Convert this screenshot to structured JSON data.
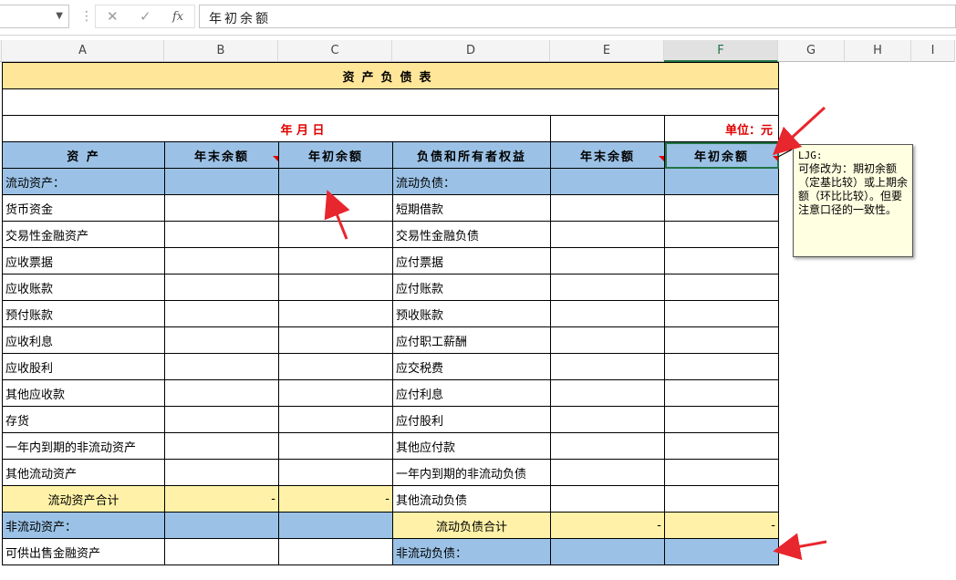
{
  "formula_bar": {
    "name_box": "",
    "cancel_icon": "✕",
    "enter_icon": "✓",
    "fx_label": "fx",
    "formula_value": "年初余额"
  },
  "columns": [
    "A",
    "B",
    "C",
    "D",
    "E",
    "F",
    "G",
    "H",
    "I"
  ],
  "selected_column": "F",
  "sheet": {
    "title": "资产负债表",
    "date_label": "年    月    日",
    "unit_label": "单位：元",
    "headers": [
      "资    产",
      "年末余额",
      "年初余额",
      "负债和所有者权益",
      "年末余额",
      "年初余额"
    ],
    "rows": [
      {
        "a": "流动资产：",
        "b": "",
        "c": "",
        "d": "流动负债：",
        "e": "",
        "f": "",
        "style": "blue"
      },
      {
        "a": "货币资金",
        "d": "短期借款"
      },
      {
        "a": "交易性金融资产",
        "d": "交易性金融负债"
      },
      {
        "a": "应收票据",
        "d": "应付票据"
      },
      {
        "a": "应收账款",
        "d": "应付账款"
      },
      {
        "a": "预付账款",
        "d": "预收账款"
      },
      {
        "a": "应收利息",
        "d": "应付职工薪酬"
      },
      {
        "a": "应收股利",
        "d": "应交税费"
      },
      {
        "a": "其他应收款",
        "d": "应付利息"
      },
      {
        "a": "存货",
        "d": "应付股利"
      },
      {
        "a": "一年内到期的非流动资产",
        "d": "其他应付款"
      },
      {
        "a": "其他流动资产",
        "d": "一年内到期的非流动负债"
      },
      {
        "a": "流动资产合计",
        "b": "-",
        "c": "-",
        "d": "其他流动负债",
        "style": "subtotal-left"
      },
      {
        "a": "非流动资产：",
        "d": "流动负债合计",
        "e": "-",
        "f": "-",
        "style": "mixed"
      },
      {
        "a": "可供出售金融资产",
        "d": "非流动负债：",
        "style": "last"
      }
    ]
  },
  "comment": {
    "author": "LJG:",
    "text": "可修改为：期初余额（定基比较）或上期余额（环比比较）。但要注意口径的一致性。"
  },
  "colors": {
    "header_blue": "#9bc2e6",
    "title_yellow": "#ffe699",
    "subtotal_yellow": "#fff2a8",
    "accent_red": "#e00000",
    "excel_green": "#217346"
  }
}
